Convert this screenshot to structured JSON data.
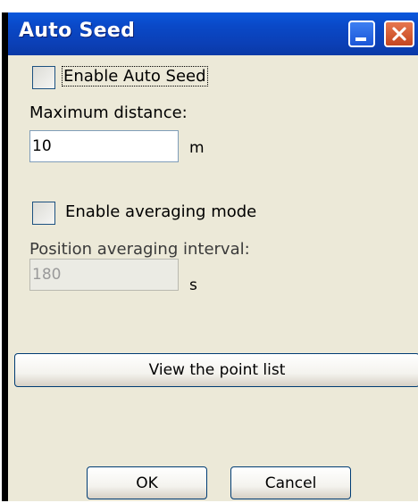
{
  "window": {
    "title": "Auto Seed"
  },
  "titlebar_buttons": {
    "minimize_icon": "minimize-icon",
    "close_icon": "close-icon"
  },
  "auto_seed": {
    "enable_label": "Enable Auto Seed",
    "enabled": false,
    "max_distance_label": "Maximum distance:",
    "max_distance_value": "10",
    "max_distance_unit": "m"
  },
  "averaging": {
    "enable_label": "Enable averaging mode",
    "enabled": false,
    "interval_label": "Position averaging interval:",
    "interval_value": "180",
    "interval_unit": "s"
  },
  "buttons": {
    "view_points": "View the point list",
    "ok": "OK",
    "cancel": "Cancel"
  },
  "colors": {
    "titlebar": "#0a49c8",
    "close_button": "#d8582f",
    "dialog_background": "#ece9d8"
  }
}
